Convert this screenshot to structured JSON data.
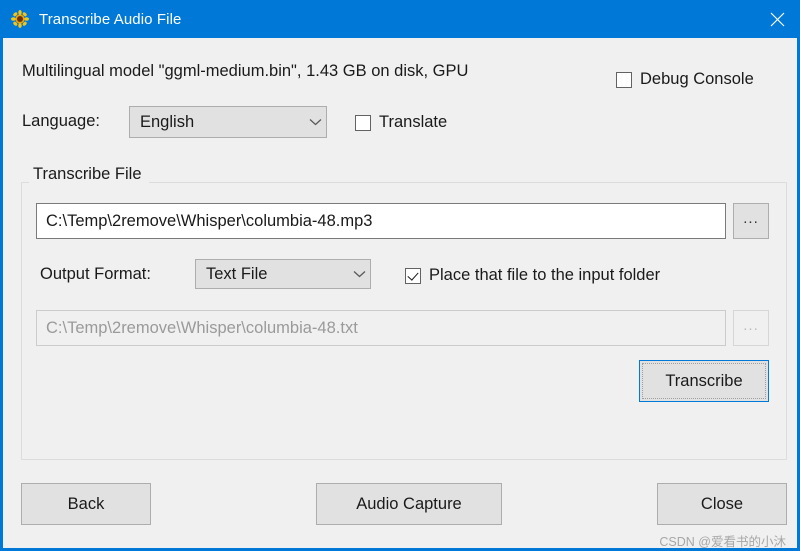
{
  "window": {
    "title": "Transcribe Audio File",
    "icon": "sunflower-icon",
    "close_glyph": "close-icon",
    "accent_color": "#0078d7",
    "background_color": "#f0f0f0"
  },
  "main": {
    "model_line": "Multilingual model \"ggml-medium.bin\", 1.43 GB on disk, GPU",
    "debug_console": {
      "label": "Debug Console",
      "checked": false
    },
    "language": {
      "label": "Language:",
      "value": "English",
      "options": [
        "English"
      ]
    },
    "translate": {
      "label": "Translate",
      "checked": false
    }
  },
  "transcribe_group": {
    "title": "Transcribe File",
    "source_file": {
      "value": "C:\\Temp\\2remove\\Whisper\\columbia-48.mp3",
      "browse_label": "..."
    },
    "output_format": {
      "label": "Output Format:",
      "value": "Text File",
      "options": [
        "Text File"
      ]
    },
    "place_file": {
      "label": "Place that file to the input folder",
      "checked": true
    },
    "output_file": {
      "value": "C:\\Temp\\2remove\\Whisper\\columbia-48.txt",
      "browse_label": "...",
      "disabled": true
    },
    "transcribe_label": "Transcribe"
  },
  "footer": {
    "back_label": "Back",
    "audio_capture_label": "Audio Capture",
    "close_label": "Close",
    "watermark": "CSDN @爱看书的小沐"
  }
}
